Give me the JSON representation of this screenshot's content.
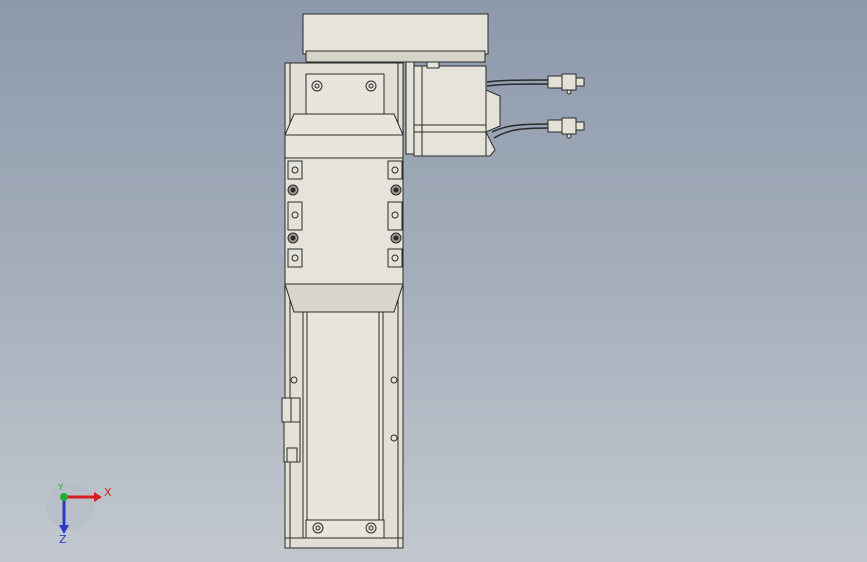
{
  "triad": {
    "x_label": "X",
    "y_label": "Y",
    "z_label": "Z",
    "x_color": "#d42020",
    "y_color": "#20b030",
    "z_color": "#2a3cc8"
  },
  "colors": {
    "background_top": "#8d99ab",
    "background_bottom": "#c3c8cf",
    "part_fill": "#e4e2d8",
    "part_shade": "#cfccc0",
    "edge": "#2a2a2a"
  }
}
